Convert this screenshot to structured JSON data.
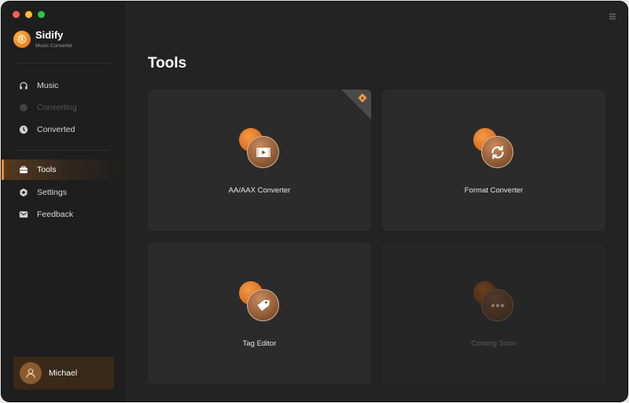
{
  "app": {
    "name": "Sidify",
    "subtitle": "Music Converter"
  },
  "sidebar": {
    "items": [
      {
        "label": "Music",
        "icon": "headphones-icon",
        "state": "normal"
      },
      {
        "label": "Converting",
        "icon": "converting-icon",
        "state": "disabled"
      },
      {
        "label": "Converted",
        "icon": "clock-icon",
        "state": "normal"
      },
      {
        "label": "Tools",
        "icon": "toolbox-icon",
        "state": "active"
      },
      {
        "label": "Settings",
        "icon": "gear-icon",
        "state": "normal"
      },
      {
        "label": "Feedback",
        "icon": "mail-icon",
        "state": "normal"
      }
    ]
  },
  "user": {
    "name": "Michael"
  },
  "main": {
    "title": "Tools",
    "cards": [
      {
        "label": "AA/AAX Converter",
        "icon": "play-video-icon",
        "badge": "premium-icon",
        "enabled": true
      },
      {
        "label": "Format Converter",
        "icon": "sync-icon",
        "enabled": true
      },
      {
        "label": "Tag Editor",
        "icon": "tag-icon",
        "enabled": true
      },
      {
        "label": "Coming Soon",
        "icon": "more-icon",
        "enabled": false
      }
    ]
  },
  "colors": {
    "accent": "#ee8a2e",
    "background": "#232323",
    "sidebar": "#1e1e1e",
    "card": "#2b2b2b"
  }
}
